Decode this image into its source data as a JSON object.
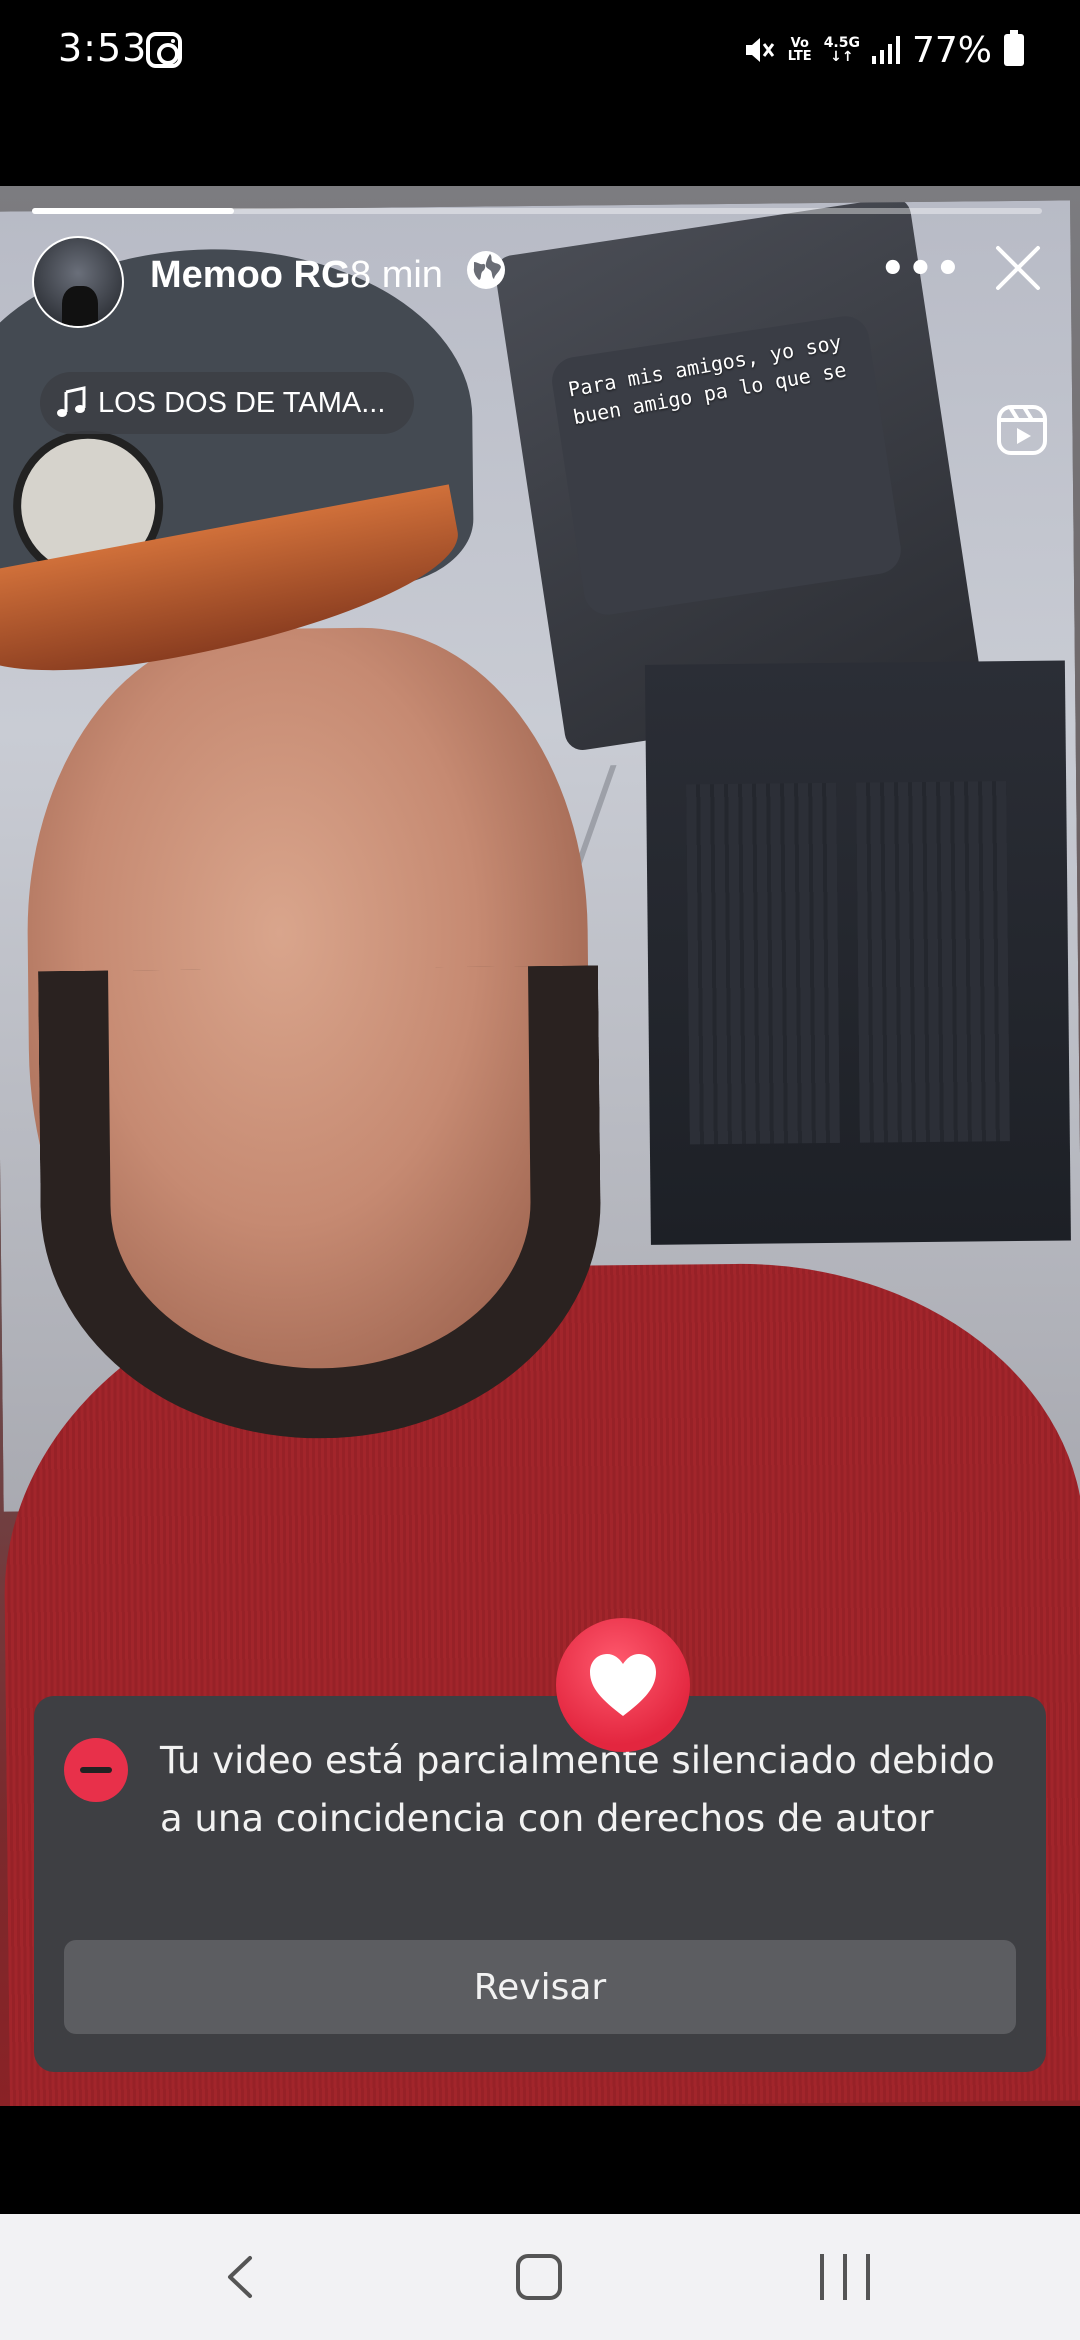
{
  "status_bar": {
    "time": "3:53",
    "volte": "Vo\nLTE",
    "network": "4.5G",
    "battery": "77%",
    "icons": [
      "instagram-icon",
      "mute-icon",
      "volte-icon",
      "signal-icon",
      "battery-icon"
    ]
  },
  "story": {
    "progress": 0.2,
    "user_name": "Memoo RG",
    "time_ago": "8 min",
    "privacy_icon": "globe-icon",
    "music_title": "LOS DOS DE TAMA...",
    "overlay_text_line1": "Para mis amigos, yo soy",
    "overlay_text_line2": "buen amigo pa lo que se"
  },
  "notice": {
    "message": "Tu video está parcialmente silenciado debido a una coincidencia con derechos de autor",
    "button_label": "Revisar"
  },
  "colors": {
    "notice_bg": "#3e3f43",
    "button_bg": "#5c5d61",
    "heart": "#e3263f",
    "shirt": "#a2252b"
  }
}
